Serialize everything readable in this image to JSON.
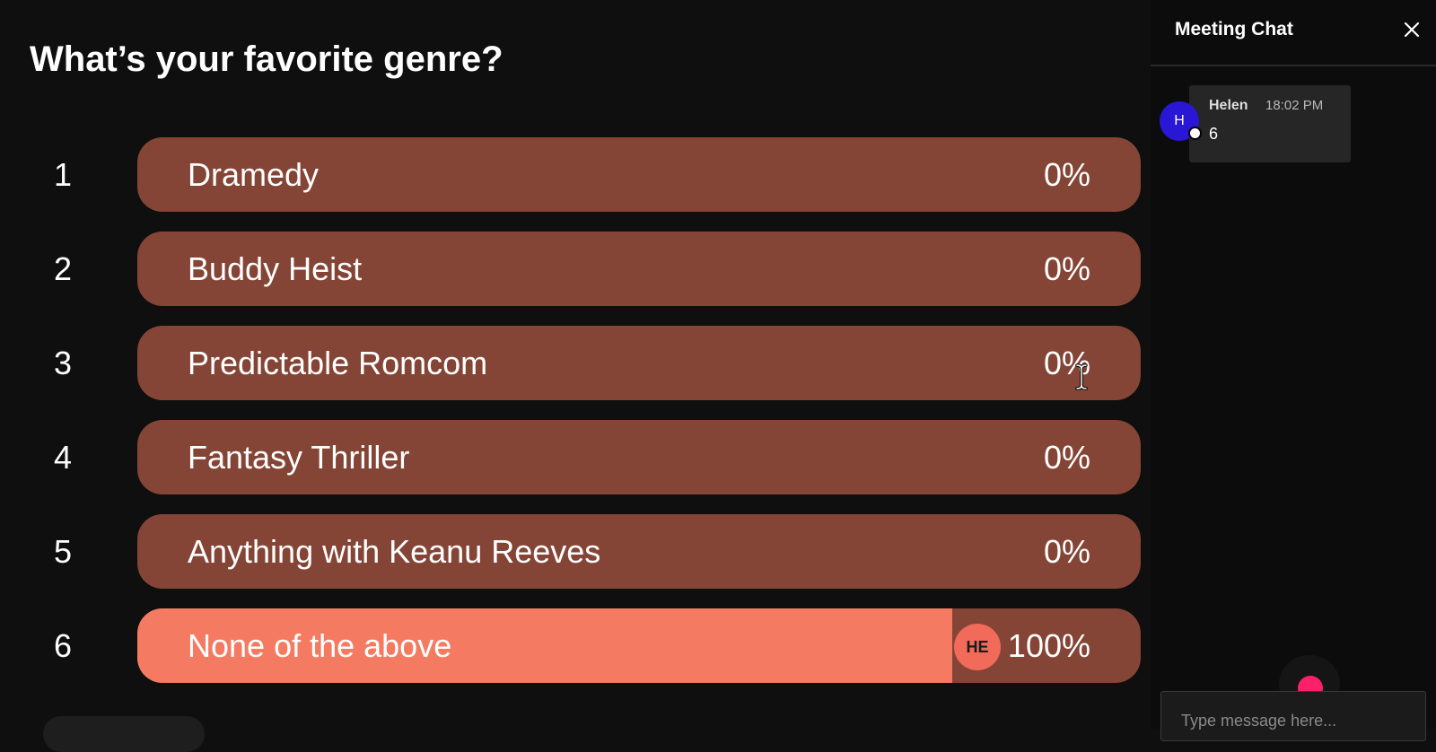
{
  "poll": {
    "question": "What’s your favorite genre?",
    "colors": {
      "bar": "#844536",
      "fill": "#f47b62",
      "background": "#0f0f0f",
      "avatar": "#f26a5a"
    },
    "options": [
      {
        "number": "1",
        "label": "Dramedy",
        "percent_text": "0%",
        "share": 0
      },
      {
        "number": "2",
        "label": "Buddy Heist",
        "percent_text": "0%",
        "share": 0
      },
      {
        "number": "3",
        "label": "Predictable Romcom",
        "percent_text": "0%",
        "share": 0
      },
      {
        "number": "4",
        "label": "Fantasy Thriller",
        "percent_text": "0%",
        "share": 0
      },
      {
        "number": "5",
        "label": "Anything with Keanu Reeves",
        "percent_text": "0%",
        "share": 0
      },
      {
        "number": "6",
        "label": "None of the above",
        "percent_text": "100%",
        "share": 100,
        "voter_initials": "HE"
      }
    ]
  },
  "chat": {
    "title": "Meeting Chat",
    "close_icon": "close-icon",
    "messages": [
      {
        "avatar_initial": "H",
        "avatar_color": "#2a17d6",
        "sender": "Helen",
        "time": "18:02 PM",
        "text": "6"
      }
    ],
    "record_color": "#ff1f6b",
    "input_placeholder": "Type message here..."
  }
}
